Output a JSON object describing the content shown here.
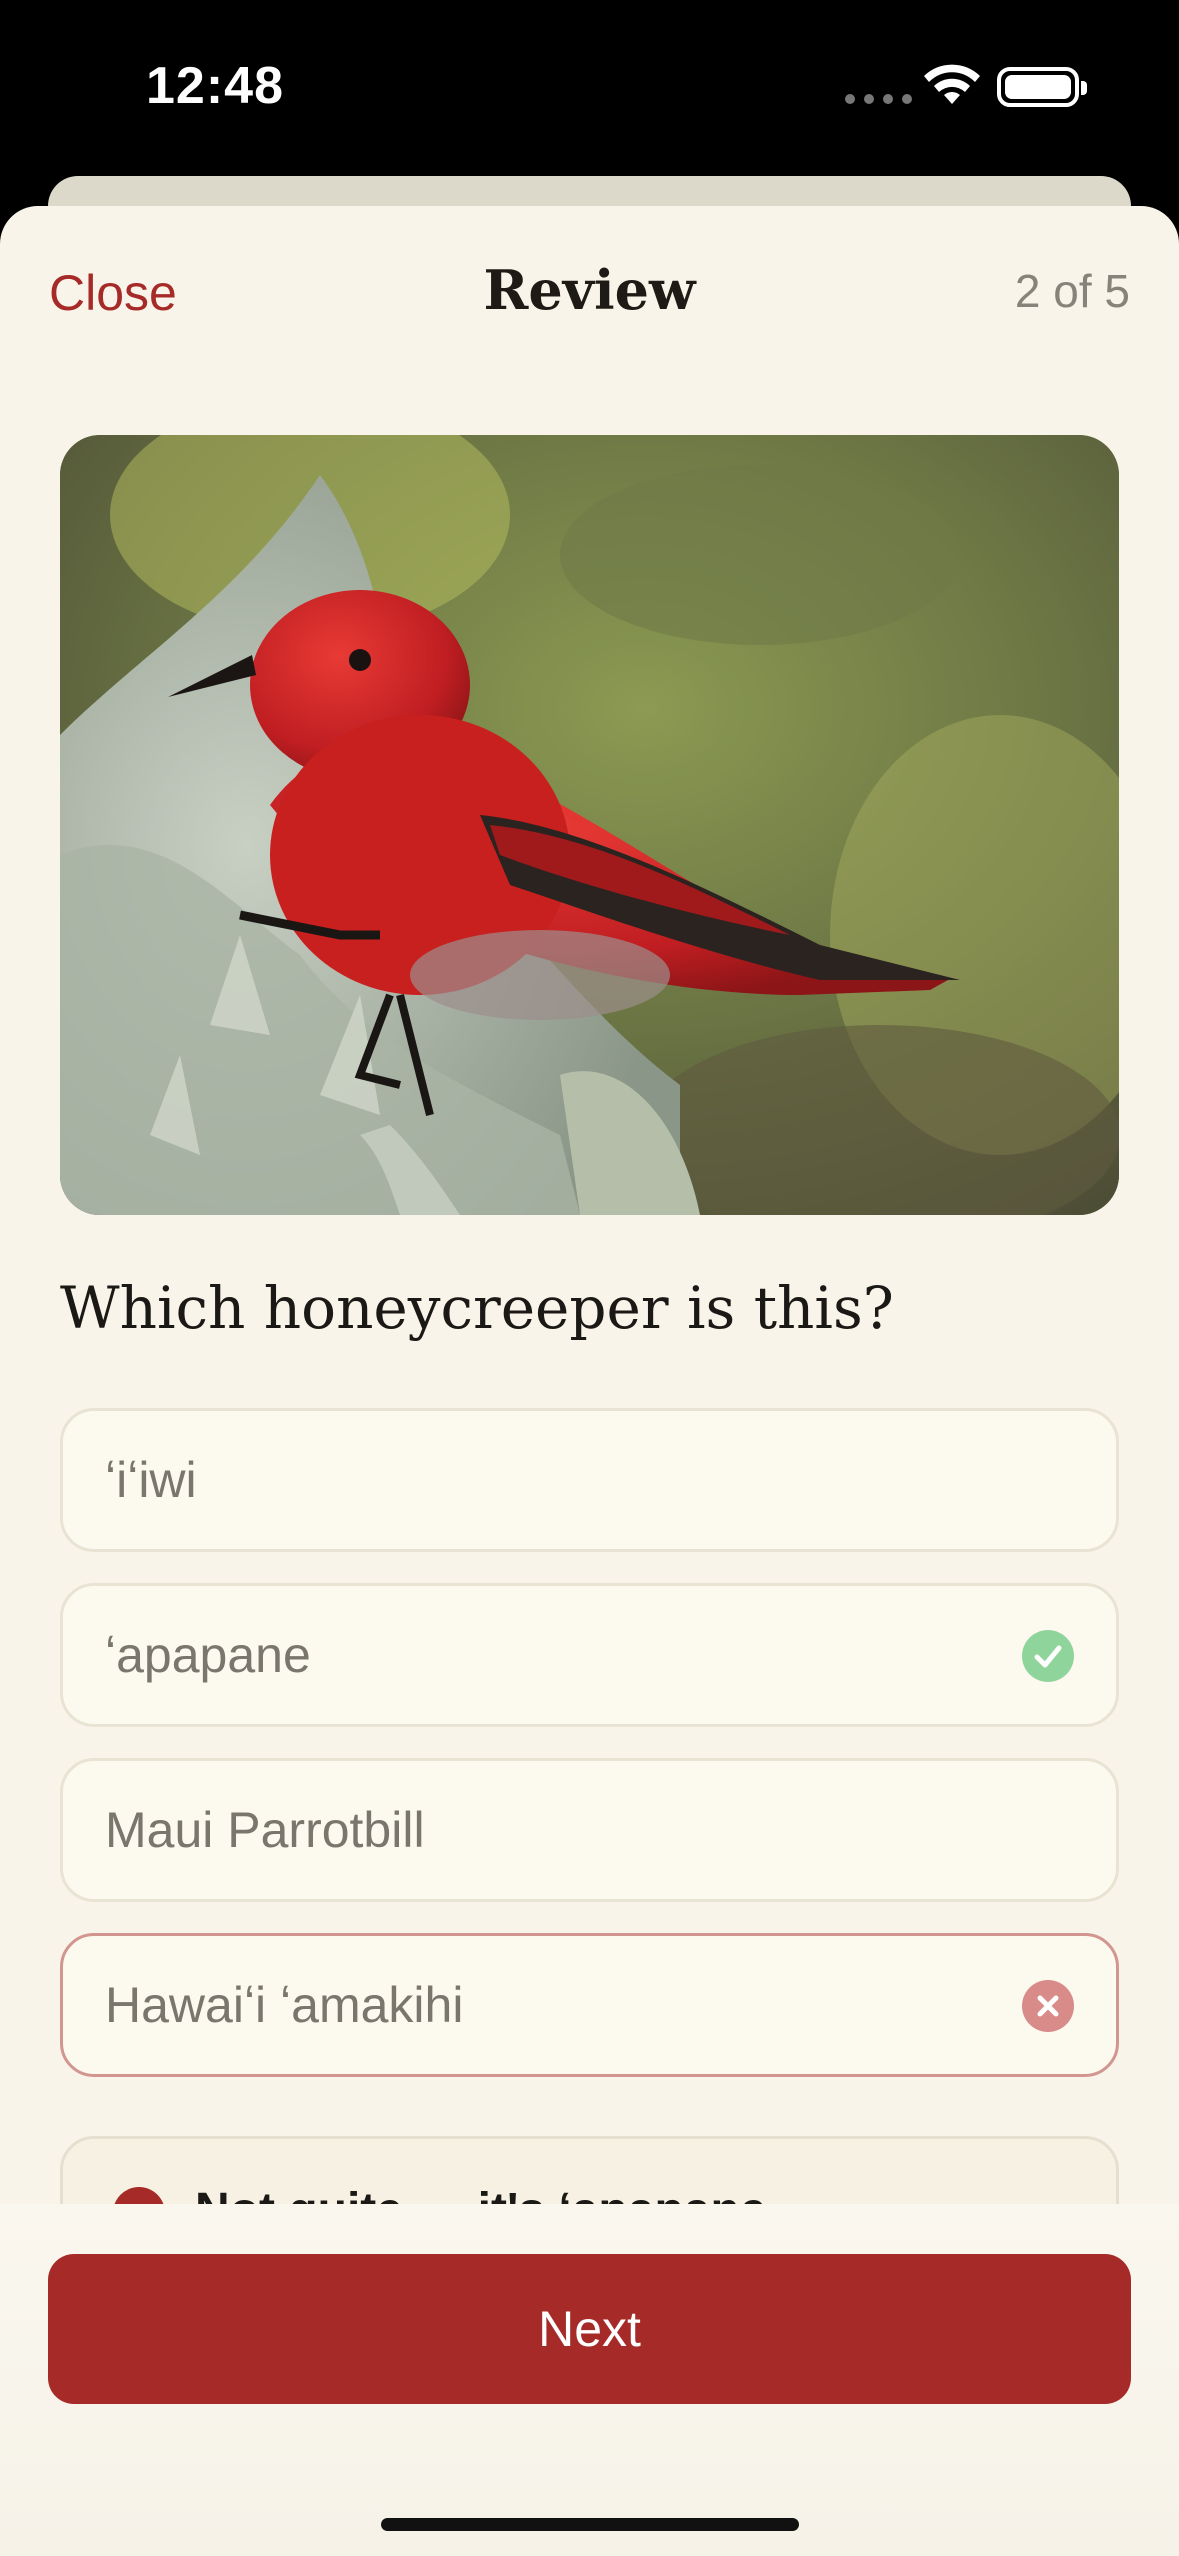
{
  "status_bar": {
    "time": "12:48"
  },
  "nav": {
    "close_label": "Close",
    "title": "Review",
    "progress": "2 of 5"
  },
  "question": "Which honeycreeper is this?",
  "options": [
    {
      "label": "ʻiʻiwi",
      "state": "neutral"
    },
    {
      "label": "ʻapapane",
      "state": "correct"
    },
    {
      "label": "Maui Parrotbill",
      "state": "neutral"
    },
    {
      "label": "Hawaiʻi ʻamakihi",
      "state": "selected-wrong"
    }
  ],
  "feedback": {
    "text": "Not quite — it's ʻapapane"
  },
  "footer": {
    "next_label": "Next"
  },
  "colors": {
    "accent": "#a62b28",
    "correct": "#8fd49b",
    "wrong": "#d88b88",
    "background": "#f9f4e9"
  }
}
